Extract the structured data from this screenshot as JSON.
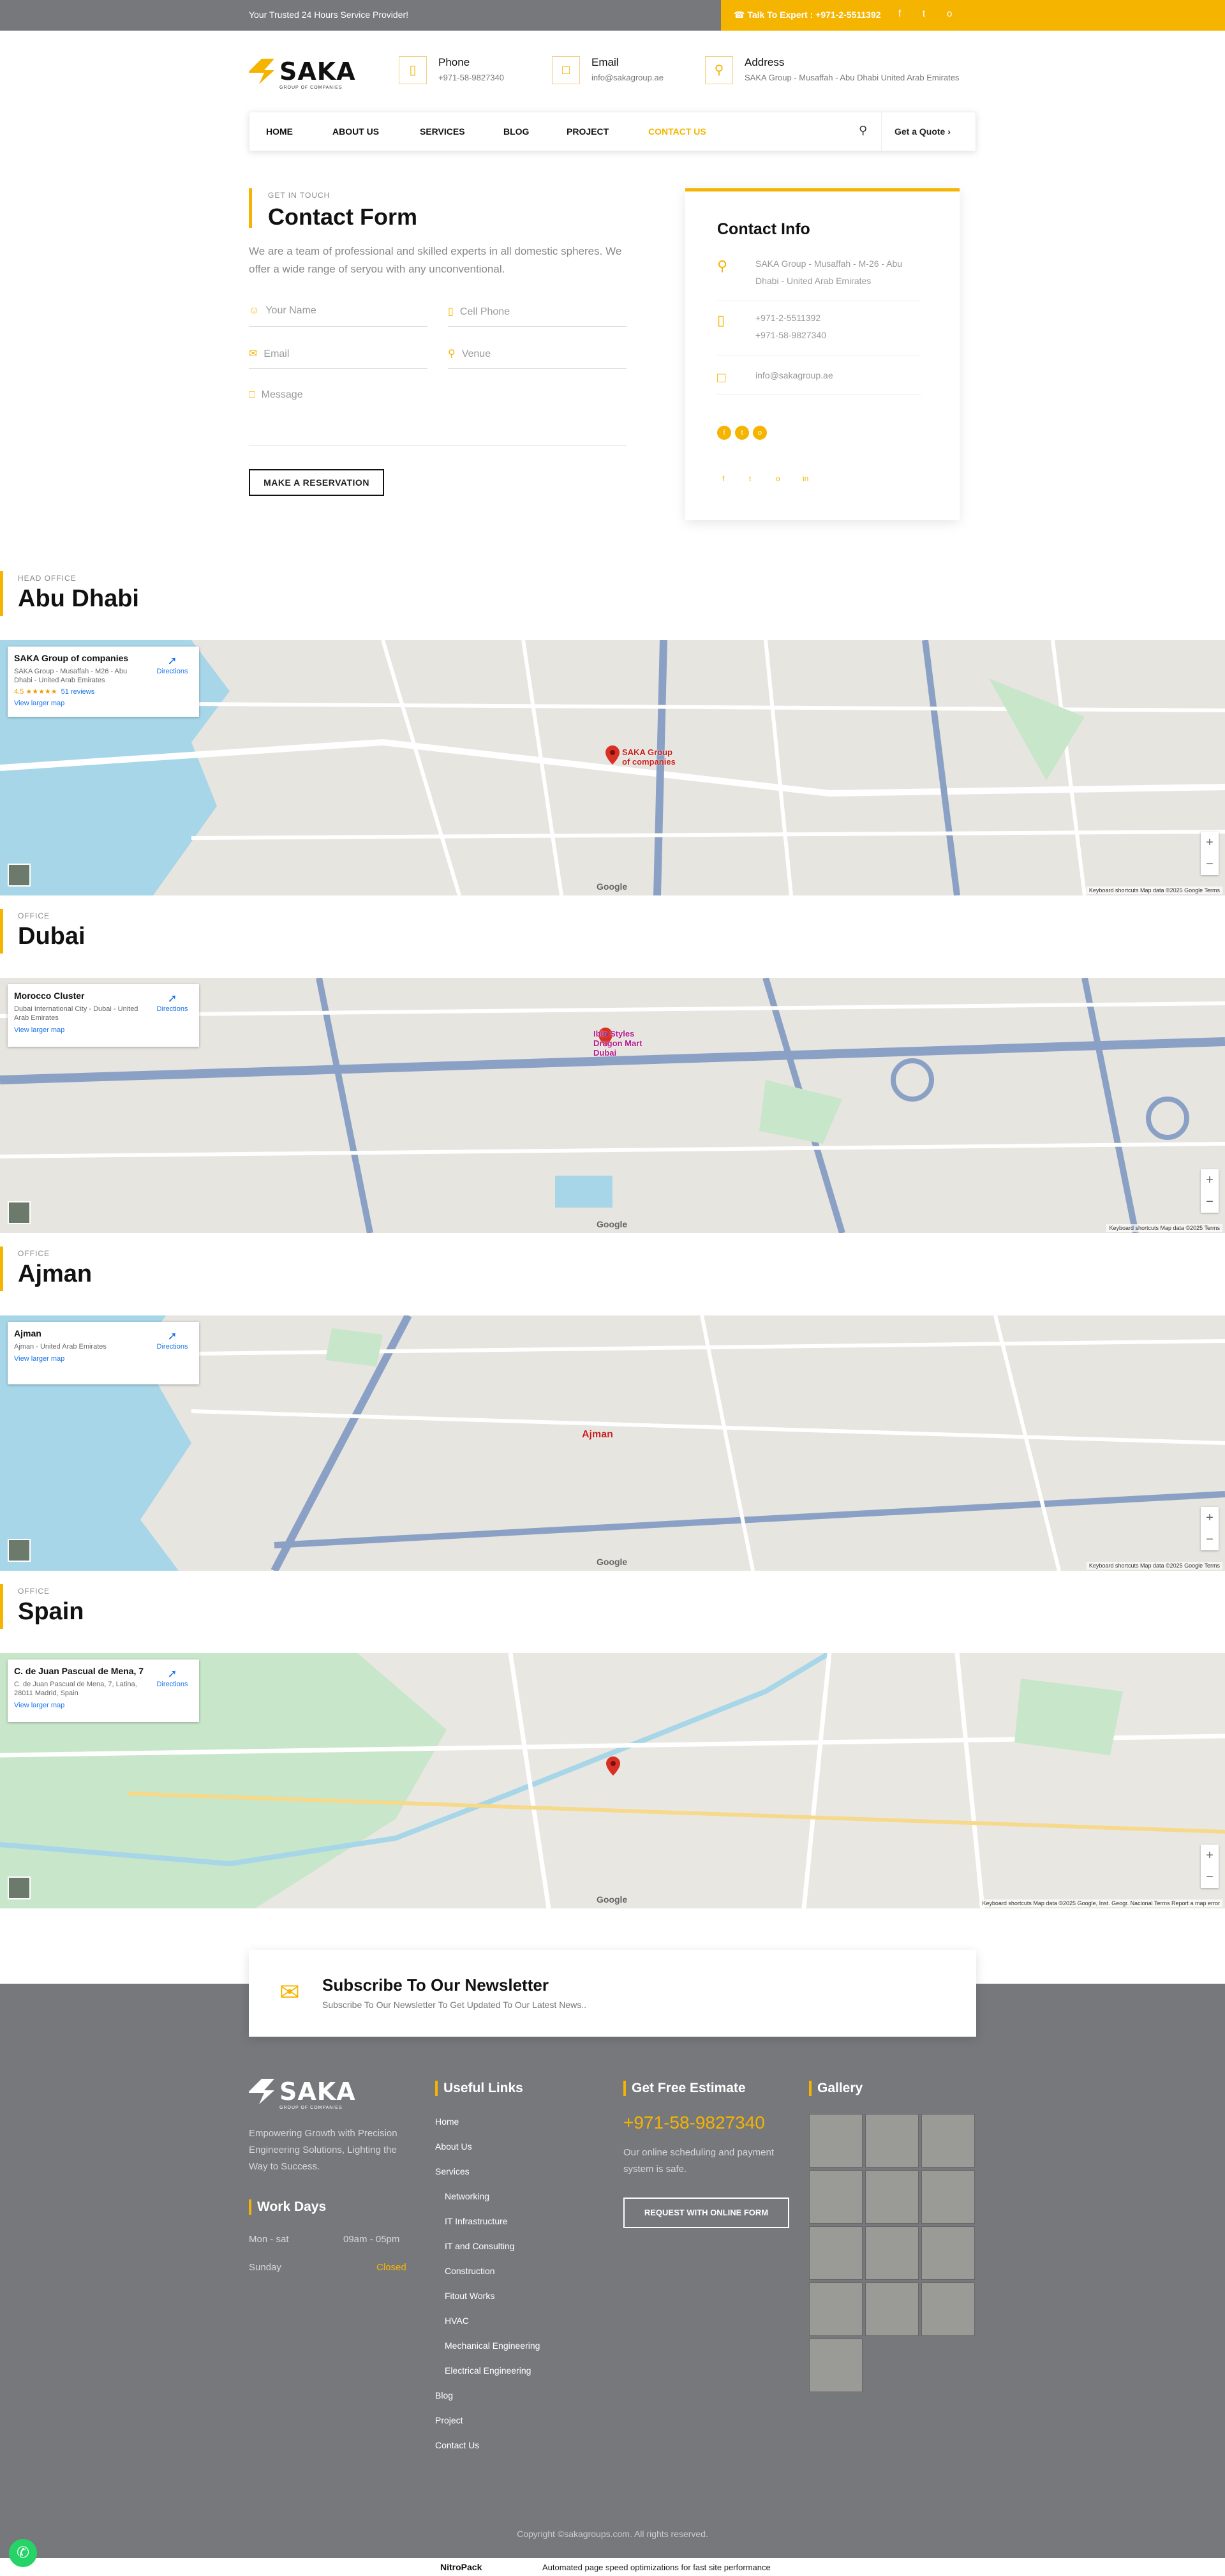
{
  "topbar": {
    "tagline": "Your Trusted 24 Hours Service Provider!",
    "cta": "☎ Talk To Expert : +971-2-5511392",
    "social": [
      "f",
      "t",
      "o"
    ]
  },
  "brand": {
    "name": "SAKA",
    "sub": "GROUP OF COMPANIES"
  },
  "contact_items": [
    {
      "label": "Phone",
      "value": "+971-58-9827340",
      "icon": "phone-icon"
    },
    {
      "label": "Email",
      "value": "info@sakagroup.ae",
      "icon": "chat-icon"
    },
    {
      "label": "Address",
      "value": "SAKA Group - Musaffah - Abu Dhabi United Arab Emirates",
      "icon": "location-icon"
    }
  ],
  "nav": {
    "items": [
      "HOME",
      "ABOUT US",
      "SERVICES",
      "BLOG",
      "PROJECT",
      "CONTACT US"
    ],
    "active": "CONTACT US",
    "quote": "Get a Quote ›"
  },
  "contact_form": {
    "kicker": "GET IN TOUCH",
    "title": "Contact Form",
    "description": "We are a team of professional and skilled experts in all domestic spheres. We offer a wide range of seryou with any unconventional.",
    "fields": {
      "name": "Your Name",
      "phone": "Cell Phone",
      "email": "Email",
      "venue": "Venue",
      "message": "Message"
    },
    "submit": "MAKE A RESERVATION"
  },
  "contact_info": {
    "title": "Contact Info",
    "address": "SAKA Group - Musaffah - M-26 - Abu Dhabi - United Arab Emirates",
    "phone1": "+971-2-5511392",
    "phone2": "+971-58-9827340",
    "email": "info@sakagroup.ae"
  },
  "offices": [
    {
      "kicker": "HEAD OFFICE",
      "name": "Abu Dhabi",
      "card_title": "SAKA Group of companies",
      "card_addr": "SAKA Group - Musaffah - M26 - Abu Dhabi - United Arab Emirates",
      "rating": "4.5 ★★★★★",
      "reviews": "51 reviews",
      "pin_label": "SAKA Group of companies",
      "footer": "Keyboard shortcuts   Map data ©2025 Google   Terms"
    },
    {
      "kicker": "OFFICE",
      "name": "Dubai",
      "card_title": "Morocco Cluster",
      "card_addr": "Dubai International City - Dubai - United Arab Emirates",
      "pin_label": "Ibis Styles Dragon Mart Dubai",
      "footer": "Keyboard shortcuts   Map data ©2025   Terms"
    },
    {
      "kicker": "OFFICE",
      "name": "Ajman",
      "card_title": "Ajman",
      "card_addr": "Ajman - United Arab Emirates",
      "pin_label": "Ajman",
      "footer": "Keyboard shortcuts   Map data ©2025 Google   Terms"
    },
    {
      "kicker": "OFFICE",
      "name": "Spain",
      "card_title": "C. de Juan Pascual de Mena, 7",
      "card_addr": "C. de Juan Pascual de Mena, 7, Latina, 28011 Madrid, Spain",
      "pin_label": "",
      "footer": "Keyboard shortcuts   Map data ©2025 Google, Inst. Geogr. Nacional   Terms   Report a map error"
    }
  ],
  "map_common": {
    "directions": "Directions",
    "larger": "View larger map",
    "google": "Google"
  },
  "newsletter": {
    "title": "Subscribe To Our Newsletter",
    "subtitle": "Subscribe To Our Newsletter To Get Updated To Our Latest News.."
  },
  "footer": {
    "about": "Empowering Growth with Precision Engineering Solutions, Lighting the Way to Success.",
    "work_days": {
      "title": "Work Days",
      "row1_day": "Mon - sat",
      "row1_time": "09am - 05pm",
      "row2_day": "Sunday",
      "row2_time": "Closed"
    },
    "useful_title": "Useful Links",
    "links": [
      "Home",
      "About Us",
      "Services"
    ],
    "sub_links": [
      "Networking",
      "IT Infrastructure",
      "IT and Consulting",
      "Construction",
      "Fitout Works",
      "HVAC",
      "Mechanical Engineering",
      "Electrical Engineering"
    ],
    "links2": [
      "Blog",
      "Project",
      "Contact Us"
    ],
    "estimate_title": "Get Free Estimate",
    "estimate_phone": "+971-58-9827340",
    "estimate_text": "Our online scheduling and payment system is safe.",
    "estimate_button": "REQUEST WITH ONLINE FORM",
    "gallery_title": "Gallery",
    "copyright": "Copyright ©sakagroups.com. All rights reserved."
  },
  "nitro": {
    "name": "NitroPack",
    "text": "Automated page speed optimizations for fast site performance"
  },
  "colors": {
    "accent": "#f5b400",
    "footer": "#77787b"
  }
}
